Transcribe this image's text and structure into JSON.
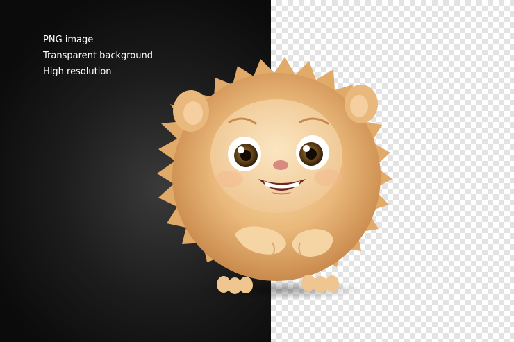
{
  "labels": {
    "line1": "PNG image",
    "line2": "Transparent background",
    "line3": "High resolution"
  },
  "colors": {
    "dark_background": "#111111",
    "checker_light": "#ffffff",
    "checker_dark": "#e3e3e3",
    "fur": "#e8b373",
    "fur_light": "#f6d6a4",
    "nose": "#d9857e",
    "eye_iris": "#6b4a1c"
  }
}
